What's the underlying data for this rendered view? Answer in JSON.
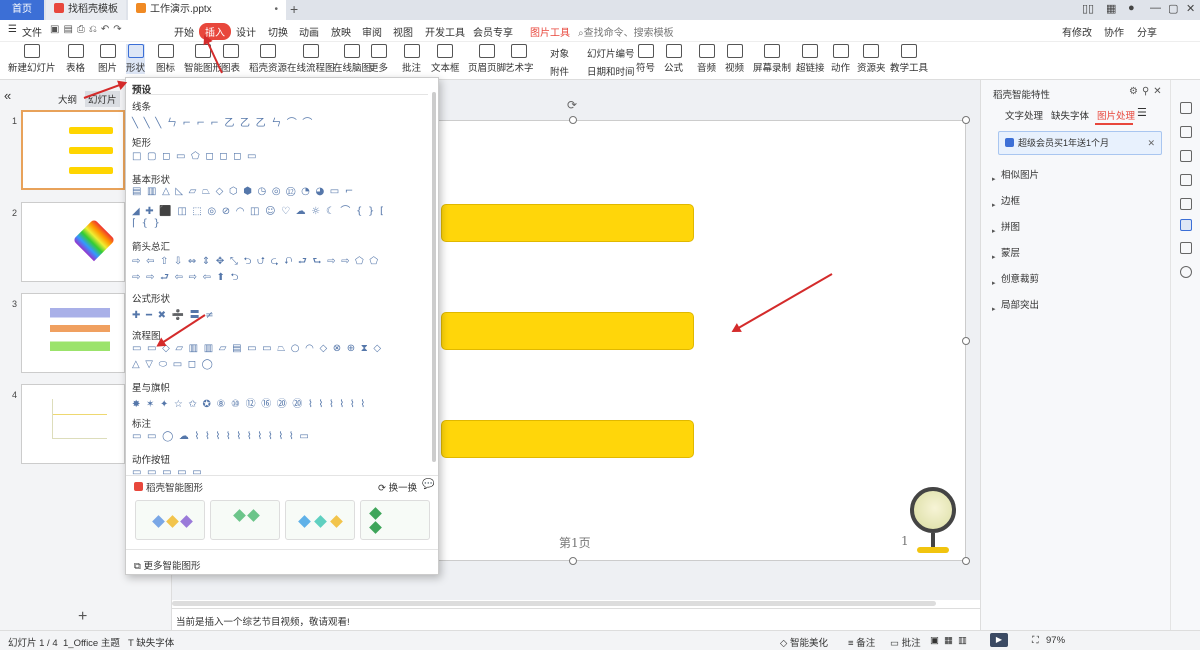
{
  "tabs": [
    {
      "label": "首页"
    },
    {
      "label": "找稻壳模板"
    },
    {
      "label": "工作演示.pptx"
    }
  ],
  "menu": {
    "file": "文件",
    "items": [
      "开始",
      "插入",
      "设计",
      "切换",
      "动画",
      "放映",
      "审阅",
      "视图",
      "开发工具",
      "会员专享"
    ],
    "active": "插入",
    "tool": "图片工具",
    "search": "查找命令、搜索模板",
    "right": [
      "有修改",
      "协作",
      "分享"
    ]
  },
  "ribbon": {
    "buttons": [
      "新建幻灯片",
      "表格",
      "图片",
      "形状",
      "图标",
      "智能图形",
      "图表",
      "稻壳资源",
      "在线流程图",
      "在线脑图",
      "更多",
      "批注",
      "文本框",
      "页眉页脚",
      "艺术字",
      "符号",
      "公式",
      "音频",
      "视频",
      "屏幕录制",
      "超链接",
      "动作",
      "资源夹",
      "教学工具"
    ],
    "small": [
      "对象",
      "幻灯片编号",
      "附件",
      "日期和时间"
    ]
  },
  "leftpanel": {
    "tabs": [
      "大纲",
      "幻灯片"
    ],
    "slides": [
      "1",
      "2",
      "3",
      "4"
    ]
  },
  "dropdown": {
    "preset": "预设",
    "sections": [
      "线条",
      "矩形",
      "基本形状",
      "箭头总汇",
      "公式形状",
      "流程图",
      "星与旗帜",
      "标注",
      "动作按钮"
    ],
    "rows": [
      "╲╲╲ㄣ⌐⌐⌐乙乙乙ㄣ⌒⌒",
      "□▢◻▭⬠◻◻◻▭",
      "▤▥△◺▱⏢◇⬡⬢◷◎⑫◔◕▭⌐",
      "◢✚⬛◫⬚◎⊘◠◫☺♡☁☼☾⌒{}[",
      "⌈{}",
      "⇨⇦⇧⇩⇔⇕✥⤡⮌⮍⮎⮏⮐⮑⇨⇨⬠⬠",
      "⇨⇨⮐⇦⇨⇦⬆⮌",
      "✚━✖➗〓≠",
      "▭▭◇▱▥▥▱▤▭▭⏢○◠◇⊗⊕⧗◇",
      "△▽⬭▭◻◯",
      "✸✶✦☆✩✪⑧⑩⑫⑯⑳⑳⌇⌇⌇⌇⌇⌇",
      "▭▭◯☁⌇⌇⌇⌇⌇⌇⌇⌇⌇⌇▭",
      "▭▭▭▭▭"
    ],
    "smart_title": "稻壳智能图形",
    "swap": "换一换",
    "more_smart": "更多智能图形"
  },
  "slide": {
    "footer": "第1页",
    "num": "1"
  },
  "rightpanel": {
    "title": "稻壳智能特性",
    "tabs": [
      "文字处理",
      "缺失字体",
      "图片处理"
    ],
    "active_tab": "图片处理",
    "banner": "超级会员买1年送1个月",
    "items": [
      "相似图片",
      "边框",
      "拼图",
      "蒙层",
      "创意裁剪",
      "局部突出"
    ]
  },
  "notes": "当前是插入一个综艺节目视频，敬请观看!",
  "status": {
    "slide": "幻灯片 1 / 4",
    "theme": "1_Office 主题",
    "font": "缺失字体",
    "beautify": "智能美化",
    "notes": "备注",
    "comment": "批注",
    "zoom": "97%"
  },
  "colors": {
    "accent": "#e8473c",
    "home_tab": "#3c6fd6",
    "shape_yellow": "#ffd60a"
  }
}
